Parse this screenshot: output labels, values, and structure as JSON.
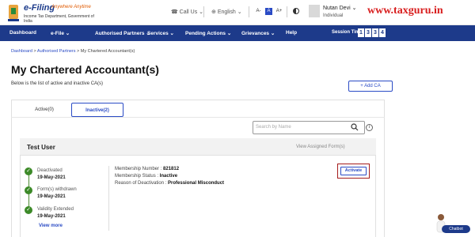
{
  "header": {
    "logo_name": "e-Filing",
    "logo_tagline": "Anywhere Anytime",
    "logo_sub": "Income Tax Department, Government of India",
    "call_us": "Call Us",
    "language": "English",
    "font_small": "A-",
    "font_normal": "A",
    "font_large": "A+",
    "user_name": "Nutan Devi",
    "user_role": "Individual",
    "watermark": "www.taxguru.in"
  },
  "nav": {
    "items": [
      "Dashboard",
      "e-File",
      "Authorised Partners",
      "Services",
      "Pending Actions",
      "Grievances",
      "Help"
    ],
    "session_label": "Session Time",
    "session_digits": [
      "1",
      "3",
      "3",
      "4"
    ]
  },
  "breadcrumb": {
    "items": [
      "Dashboard",
      "Authorised Partners",
      "My Chartered Accountant(s)"
    ],
    "separator": ">"
  },
  "page": {
    "title": "My Chartered Accountant(s)",
    "description": "Below is the list of active and inactive CA(s)",
    "add_button": "+ Add CA"
  },
  "tabs": [
    {
      "label": "Active(0)",
      "active": false
    },
    {
      "label": "Inactive(2)",
      "active": true
    }
  ],
  "search": {
    "placeholder": "Search by Name"
  },
  "card": {
    "name": "Test User",
    "view_forms": "View Assigned Form(s)",
    "timeline": [
      {
        "label": "Deactivated",
        "date": "19-May-2021"
      },
      {
        "label": "Form(s) withdrawn",
        "date": "19-May-2021"
      },
      {
        "label": "Validity Extended",
        "date": "19-May-2021"
      }
    ],
    "view_more": "View more",
    "membership_number_label": "Membership Number :",
    "membership_number": "821812",
    "membership_status_label": "Membership Status :",
    "membership_status": "Inactive",
    "deactivation_reason_label": "Reason of Deactivation :",
    "deactivation_reason": "Professional Misconduct",
    "activate_button": "Activate"
  },
  "chatbot": {
    "label": "Chatbot"
  },
  "colors": {
    "nav_bg": "#1d3a8a",
    "accent": "#2a4bc5",
    "success": "#3c8a28",
    "highlight": "#a51c1c",
    "watermark": "#d81d1d"
  }
}
